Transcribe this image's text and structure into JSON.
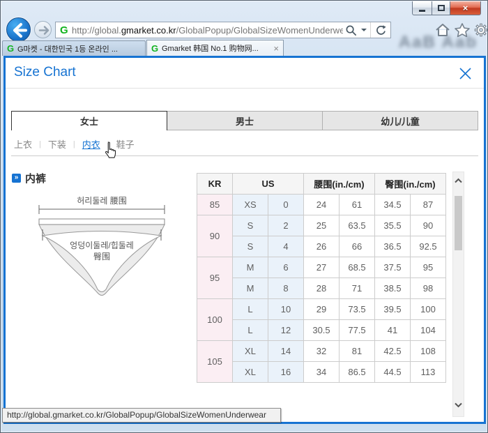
{
  "colors": {
    "accent_blue": "#1673d2",
    "kr_col_pink": "#fbeef3",
    "us_col_blue": "#eaf2fa",
    "header_gray": "#f5f5f5",
    "g_logo_green": "#12b31f"
  },
  "icons": {
    "g_logo": "G",
    "window_close": "×",
    "tab_close": "×",
    "section_marker": "»",
    "subnav_separator": "|"
  },
  "browser": {
    "url_prefix": "http://global.",
    "url_domain": "gmarket.co.kr",
    "url_path": "/GlobalPopup/GlobalSizeWomenUnderwear",
    "wallpaper_text": "AaB Aab",
    "tabs": [
      {
        "label": "G마켓 - 대한민국 1등 온라인 ..."
      },
      {
        "label": "Gmarket 韩国 No.1 购物网..."
      }
    ],
    "status_text": "http://global.gmarket.co.kr/GlobalPopup/GlobalSizeWomenUnderwear"
  },
  "popup": {
    "title": "Size Chart",
    "category_tabs": [
      {
        "label": "女士",
        "active": true
      },
      {
        "label": "男士",
        "active": false
      },
      {
        "label": "幼儿/儿童",
        "active": false
      }
    ],
    "subnav": [
      {
        "label": "上衣",
        "active": false
      },
      {
        "label": "下装",
        "active": false
      },
      {
        "label": "内衣",
        "active": true
      },
      {
        "label": "鞋子",
        "active": false
      }
    ],
    "section_title": "内裤",
    "diagram": {
      "waist_label": "허리둘레 腰围",
      "hip_label_line1": "엉덩이둘레/힙둘레",
      "hip_label_line2": "臀围"
    },
    "table": {
      "headers": [
        "KR",
        "US",
        "腰围(in./cm)",
        "臀围(in./cm)"
      ],
      "rows": [
        {
          "kr": "85",
          "us_size": "XS",
          "us_num": "0",
          "waist_in": "24",
          "waist_cm": "61",
          "hip_in": "34.5",
          "hip_cm": "87"
        },
        {
          "kr": "90",
          "us_size": "S",
          "us_num": "2",
          "waist_in": "25",
          "waist_cm": "63.5",
          "hip_in": "35.5",
          "hip_cm": "90"
        },
        {
          "us_size": "S",
          "us_num": "4",
          "waist_in": "26",
          "waist_cm": "66",
          "hip_in": "36.5",
          "hip_cm": "92.5"
        },
        {
          "kr": "95",
          "us_size": "M",
          "us_num": "6",
          "waist_in": "27",
          "waist_cm": "68.5",
          "hip_in": "37.5",
          "hip_cm": "95"
        },
        {
          "us_size": "M",
          "us_num": "8",
          "waist_in": "28",
          "waist_cm": "71",
          "hip_in": "38.5",
          "hip_cm": "98"
        },
        {
          "kr": "100",
          "us_size": "L",
          "us_num": "10",
          "waist_in": "29",
          "waist_cm": "73.5",
          "hip_in": "39.5",
          "hip_cm": "100"
        },
        {
          "us_size": "L",
          "us_num": "12",
          "waist_in": "30.5",
          "waist_cm": "77.5",
          "hip_in": "41",
          "hip_cm": "104"
        },
        {
          "kr": "105",
          "us_size": "XL",
          "us_num": "14",
          "waist_in": "32",
          "waist_cm": "81",
          "hip_in": "42.5",
          "hip_cm": "108"
        },
        {
          "us_size": "XL",
          "us_num": "16",
          "waist_in": "34",
          "waist_cm": "86.5",
          "hip_in": "44.5",
          "hip_cm": "113"
        }
      ]
    }
  }
}
